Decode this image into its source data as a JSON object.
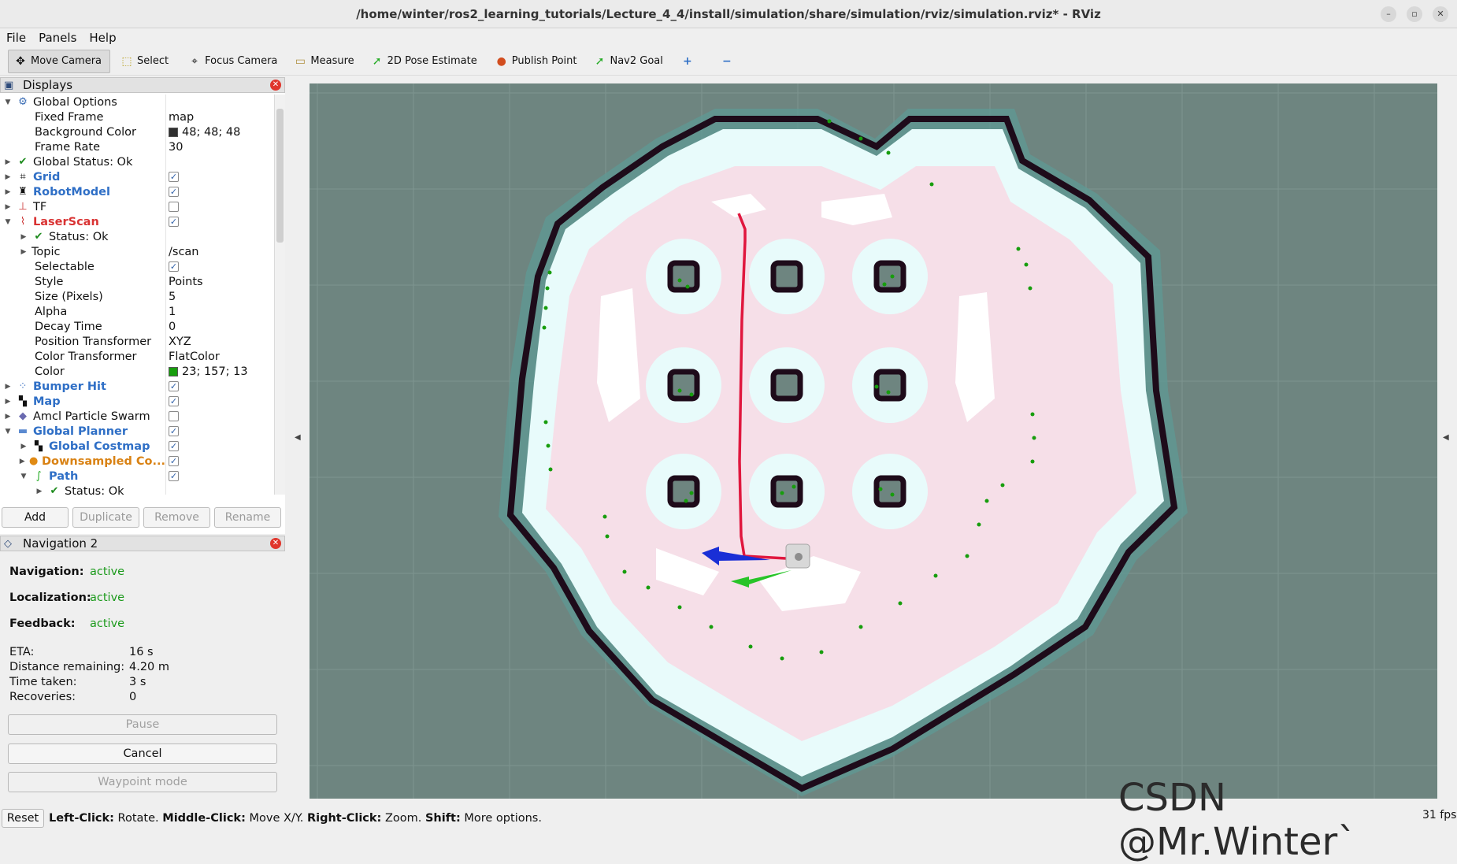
{
  "window": {
    "title": "/home/winter/ros2_learning_tutorials/Lecture_4_4/install/simulation/share/simulation/rviz/simulation.rviz* - RViz"
  },
  "menu": [
    "File",
    "Panels",
    "Help"
  ],
  "toolbar": {
    "tools": [
      {
        "label": "Move Camera",
        "icon": "move-camera-icon",
        "active": true
      },
      {
        "label": "Select",
        "icon": "select-icon"
      },
      {
        "label": "Focus Camera",
        "icon": "focus-camera-icon"
      },
      {
        "label": "Measure",
        "icon": "ruler-icon"
      },
      {
        "label": "2D Pose Estimate",
        "icon": "pose-estimate-icon"
      },
      {
        "label": "Publish Point",
        "icon": "map-pin-icon"
      },
      {
        "label": "Nav2 Goal",
        "icon": "nav-goal-icon"
      }
    ]
  },
  "displays": {
    "title": "Displays",
    "global_options": "Global Options",
    "fixed_frame": {
      "label": "Fixed Frame",
      "value": "map"
    },
    "background_color": {
      "label": "Background Color",
      "value": "48; 48; 48",
      "swatch": "#303030"
    },
    "frame_rate": {
      "label": "Frame Rate",
      "value": "30"
    },
    "global_status": "Global Status: Ok",
    "grid": "Grid",
    "robot_model": "RobotModel",
    "tf": "TF",
    "laser_scan": "LaserScan",
    "laser_status": "Status: Ok",
    "topic": {
      "label": "Topic",
      "value": "/scan"
    },
    "selectable": {
      "label": "Selectable"
    },
    "style": {
      "label": "Style",
      "value": "Points"
    },
    "size": {
      "label": "Size (Pixels)",
      "value": "5"
    },
    "alpha": {
      "label": "Alpha",
      "value": "1"
    },
    "decay": {
      "label": "Decay Time",
      "value": "0"
    },
    "position_transformer": {
      "label": "Position Transformer",
      "value": "XYZ"
    },
    "color_transformer": {
      "label": "Color Transformer",
      "value": "FlatColor"
    },
    "color": {
      "label": "Color",
      "value": "23; 157; 13",
      "swatch": "#179d0d"
    },
    "bumper_hit": "Bumper Hit",
    "map": "Map",
    "amcl": "Amcl Particle Swarm",
    "global_planner": "Global Planner",
    "global_costmap": "Global Costmap",
    "downsampled": "Downsampled Co...",
    "path": "Path",
    "path_status": "Status: Ok",
    "buttons": {
      "add": "Add",
      "duplicate": "Duplicate",
      "remove": "Remove",
      "rename": "Rename"
    }
  },
  "navigation": {
    "title": "Navigation 2",
    "navigation": {
      "label": "Navigation:",
      "value": "active"
    },
    "localization": {
      "label": "Localization:",
      "value": "active"
    },
    "feedback": {
      "label": "Feedback:",
      "value": "active"
    },
    "eta": {
      "label": "ETA:",
      "value": "16 s"
    },
    "distance": {
      "label": "Distance remaining:",
      "value": "4.20 m"
    },
    "time_taken": {
      "label": "Time taken:",
      "value": "3 s"
    },
    "recoveries": {
      "label": "Recoveries:",
      "value": "0"
    },
    "pause": "Pause",
    "cancel": "Cancel",
    "waypoint": "Waypoint mode"
  },
  "viewport": {
    "fps": "31 fps",
    "watermark": "CSDN @Mr.Winter`",
    "colors": {
      "background": "#6e8580",
      "free": "#ffffff",
      "cost_inflation": "#f4dde6",
      "inscribed": "#e6fbfb",
      "wall": "#1e0b1a",
      "scan": "#179d0d",
      "path": "#e0173e"
    }
  },
  "status": {
    "reset": "Reset",
    "lc": "Left-Click:",
    "lc_v": " Rotate. ",
    "mc": "Middle-Click:",
    "mc_v": " Move X/Y. ",
    "rc": "Right-Click:",
    "rc_v": " Zoom. ",
    "sh": "Shift:",
    "sh_v": " More options."
  }
}
